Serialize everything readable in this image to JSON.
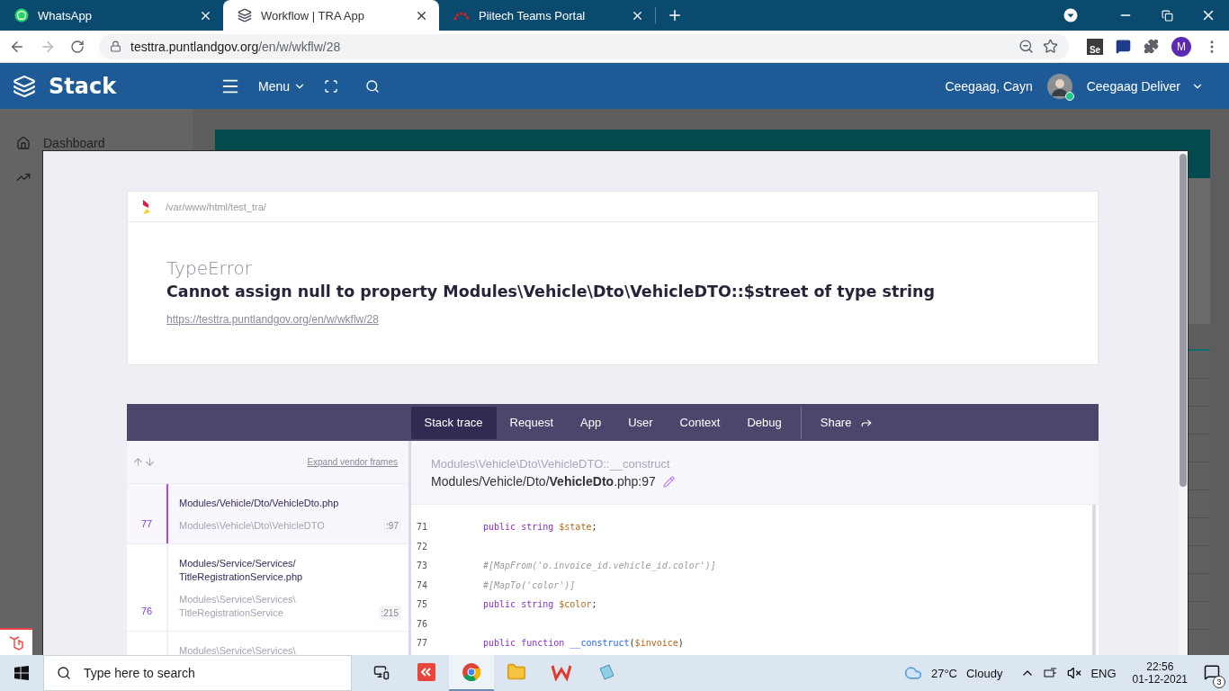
{
  "browser": {
    "tabs": [
      {
        "title": "WhatsApp",
        "kind": "chat",
        "selected": false
      },
      {
        "title": "Workflow | TRA App",
        "kind": "layers",
        "selected": true
      },
      {
        "title": "Piitech Teams Portal",
        "kind": "arc",
        "selected": false
      }
    ],
    "address": {
      "host": "testtra.puntlandgov.org",
      "path": "/en/w/wkflw/28"
    },
    "extension_label": "Se",
    "profile_initial": "M"
  },
  "app_header": {
    "brand": "Stack",
    "menu": "Menu",
    "user_name": "Ceegaag, Cayn",
    "account": "Ceegaag Deliver",
    "online": true
  },
  "sidebar": {
    "items": [
      {
        "label": "Dashboard",
        "kind": "home"
      },
      {
        "kind": "trend"
      }
    ]
  },
  "error": {
    "root_path": "/var/www/html/test_tra/",
    "type": "TypeError",
    "message": "Cannot assign null to property Modules\\Vehicle\\Dto\\VehicleDTO::$street of type string",
    "url": "https://testtra.puntlandgov.org/en/w/wkflw/28"
  },
  "tabs": [
    {
      "label": "Stack trace",
      "selected": true
    },
    {
      "label": "Request",
      "selected": false
    },
    {
      "label": "App",
      "selected": false
    },
    {
      "label": "User",
      "selected": false
    },
    {
      "label": "Context",
      "selected": false
    },
    {
      "label": "Debug",
      "selected": false
    }
  ],
  "share": "Share",
  "expand_vendor_frames": "Expand vendor frames",
  "frames": [
    {
      "number": "77",
      "file": "Modules/Vehicle/Dto/VehicleDto.php",
      "class": "Modules\\Vehicle\\Dto\\VehicleDTO",
      "line": ":97",
      "selected": true
    },
    {
      "number": "76",
      "file": "Modules/Service/Services/TitleRegistrationService.php",
      "class": "Modules\\Service\\Services\\TitleRegistrationService",
      "line": ":215",
      "selected": false
    },
    {
      "class": "Modules\\Service\\Services\\",
      "selected": false
    }
  ],
  "frame_detail": {
    "method": "Modules\\Vehicle\\Dto\\VehicleDTO::__construct",
    "file": "Modules/Vehicle/Dto/**VehicleDto**.php:97"
  },
  "code_lines": [
    {
      "number": "71",
      "tokens": [
        {
          "text": "public ",
          "kind": "keyword"
        },
        {
          "text": "string ",
          "kind": "keyword"
        },
        {
          "text": "$state",
          "kind": "variable"
        },
        {
          "text": ";",
          "kind": "plain"
        }
      ]
    },
    {
      "number": "72"
    },
    {
      "number": "73",
      "tokens": [
        {
          "text": "#[MapFrom('o.invoice_id.vehicle_id.color')]",
          "kind": "comment"
        }
      ]
    },
    {
      "number": "74",
      "tokens": [
        {
          "text": "#[MapTo('color')]",
          "kind": "comment"
        }
      ]
    },
    {
      "number": "75",
      "tokens": [
        {
          "text": "public ",
          "kind": "keyword"
        },
        {
          "text": "string ",
          "kind": "keyword"
        },
        {
          "text": "$color",
          "kind": "variable"
        },
        {
          "text": ";",
          "kind": "plain"
        }
      ]
    },
    {
      "number": "76"
    },
    {
      "number": "77",
      "tokens": [
        {
          "text": "public ",
          "kind": "keyword"
        },
        {
          "text": "function ",
          "kind": "keyword"
        },
        {
          "text": "__construct",
          "kind": "function"
        },
        {
          "text": "(",
          "kind": "plain"
        },
        {
          "text": "$invoice",
          "kind": "variable"
        },
        {
          "text": ")",
          "kind": "plain"
        }
      ]
    }
  ],
  "taskbar": {
    "search_placeholder": "Type here to search",
    "apps": [
      {
        "kind": "arrows"
      },
      {
        "kind": "chrome",
        "selected": true
      },
      {
        "kind": "folder",
        "selected": false
      },
      {
        "kind": "office"
      },
      {
        "kind": "notepad"
      }
    ],
    "temperature": "27°C",
    "weather": "Cloudy",
    "language": "ENG",
    "time": "22:56",
    "date": "01-12-2021",
    "notifications": "3"
  }
}
